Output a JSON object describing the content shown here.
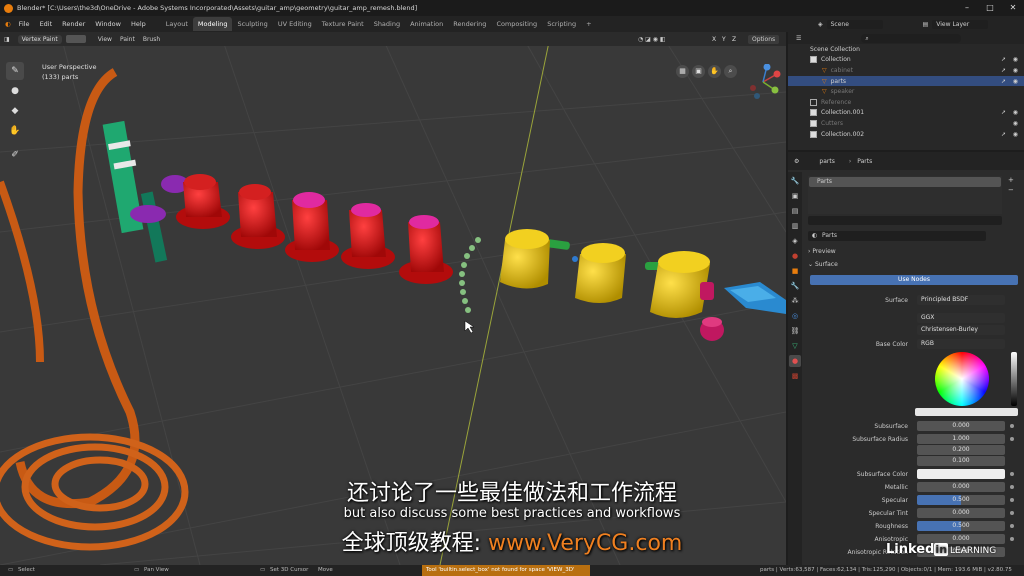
{
  "window": {
    "title": "Blender* [C:\\Users\\the3d\\OneDrive - Adobe Systems Incorporated\\Assets\\guitar_amp\\geometry\\guitar_amp_remesh.blend]",
    "minimize": "–",
    "maximize": "□",
    "close": "✕"
  },
  "menu": {
    "items": [
      "File",
      "Edit",
      "Render",
      "Window",
      "Help"
    ],
    "workspaces": [
      "Layout",
      "Modeling",
      "Sculpting",
      "UV Editing",
      "Texture Paint",
      "Shading",
      "Animation",
      "Rendering",
      "Compositing",
      "Scripting",
      "+"
    ],
    "active_workspace": "Modeling"
  },
  "scene": {
    "label": "Scene",
    "view_layer": "View Layer"
  },
  "viewport": {
    "mode": "Vertex Paint",
    "menus": [
      "View",
      "Paint",
      "Brush"
    ],
    "perspective": "User Perspective",
    "object_info": "(133) parts",
    "options_label": "Options",
    "axes": [
      "X",
      "Y",
      "Z"
    ]
  },
  "outliner": {
    "root": "Scene Collection",
    "rows": [
      {
        "name": "Collection",
        "dim": false,
        "selected": false
      },
      {
        "name": "cabinet",
        "dim": true,
        "selected": false
      },
      {
        "name": "parts",
        "dim": false,
        "selected": true
      },
      {
        "name": "speaker",
        "dim": true,
        "selected": false
      },
      {
        "name": "Reference",
        "dim": true,
        "selected": false
      },
      {
        "name": "Collection.001",
        "dim": false,
        "selected": false
      },
      {
        "name": "Cutters",
        "dim": true,
        "selected": false
      },
      {
        "name": "Collection.002",
        "dim": false,
        "selected": false
      }
    ]
  },
  "properties": {
    "object": "parts",
    "material_slot_header": "Parts",
    "slot": "Parts",
    "material_name": "Parts",
    "preview_label": "Preview",
    "surface_section": "Surface",
    "use_nodes": "Use Nodes",
    "rows": {
      "surface": {
        "label": "Surface",
        "value": "Principled BSDF"
      },
      "distribution": {
        "label": "",
        "value": "GGX"
      },
      "subsurface_method": {
        "label": "",
        "value": "Christensen-Burley"
      },
      "base_color": {
        "label": "Base Color",
        "value": "RGB"
      },
      "subsurface": {
        "label": "Subsurface",
        "value": "0.000"
      },
      "subsurface_radius": {
        "label": "Subsurface Radius",
        "values": [
          "1.000",
          "0.200",
          "0.100"
        ]
      },
      "subsurface_color": {
        "label": "Subsurface Color",
        "value": ""
      },
      "metallic": {
        "label": "Metallic",
        "value": "0.000"
      },
      "specular": {
        "label": "Specular",
        "value": "0.500"
      },
      "specular_tint": {
        "label": "Specular Tint",
        "value": "0.000"
      },
      "roughness": {
        "label": "Roughness",
        "value": "0.500"
      },
      "anisotropic": {
        "label": "Anisotropic",
        "value": "0.000"
      },
      "anisotropic_rotation": {
        "label": "Anisotropic Rotation",
        "value": "0.000"
      }
    }
  },
  "status": {
    "select": "Select",
    "pan": "Pan View",
    "cursor": "Set 3D Cursor",
    "move": "Move",
    "warning": "Tool 'builtin.select_box' not found for space 'VIEW_3D'",
    "stats": "parts | Verts:63,587 | Faces:62,134 | Tris:125,290 | Objects:0/1 | Mem: 193.6 MiB | v2.80.75"
  },
  "subtitles": {
    "cn": "还讨论了一些最佳做法和工作流程",
    "en": "but also discuss some best practices and workflows",
    "promo_prefix": "全球顶级教程: ",
    "promo_url": "www.VeryCG.com"
  },
  "branding": {
    "linkedin": "Linked",
    "in": "in",
    "learning": "LEARNING"
  },
  "colors": {
    "accent": "#e87d0d",
    "selection": "#334d80",
    "promo": "#f08020"
  }
}
